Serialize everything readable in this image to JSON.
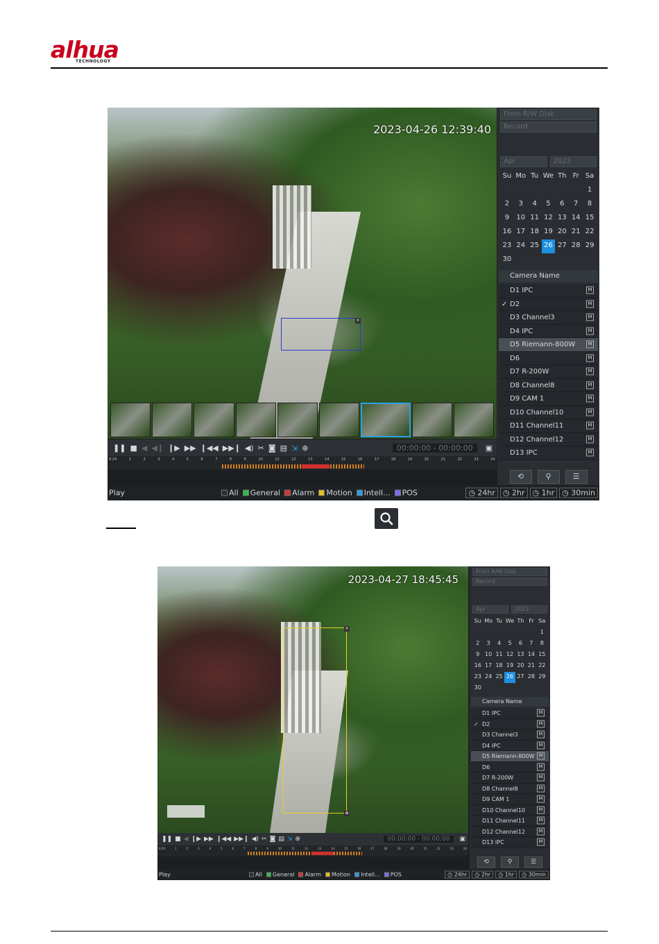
{
  "logo": {
    "brand": "alhua",
    "sub": "TECHNOLOGY"
  },
  "icons": {
    "zoom": "magnify-icon"
  },
  "screen1": {
    "timestamp": "2023-04-26 12:39:40",
    "source": "From R/W Disk",
    "type": "Record",
    "month": "Apr",
    "year": "2023",
    "weekdays": [
      "Su",
      "Mo",
      "Tu",
      "We",
      "Th",
      "Fr",
      "Sa"
    ],
    "weeks": [
      [
        "",
        "",
        "",
        "",
        "",
        "",
        "1"
      ],
      [
        "2",
        "3",
        "4",
        "5",
        "6",
        "7",
        "8"
      ],
      [
        "9",
        "10",
        "11",
        "12",
        "13",
        "14",
        "15"
      ],
      [
        "16",
        "17",
        "18",
        "19",
        "20",
        "21",
        "22"
      ],
      [
        "23",
        "24",
        "25",
        "26",
        "27",
        "28",
        "29"
      ],
      [
        "30",
        "",
        "",
        "",
        "",
        "",
        ""
      ]
    ],
    "camera_header": "Camera Name",
    "cameras": [
      "D1 IPC",
      "D2",
      "D3 Channel3",
      "D4 IPC",
      "D5 Riemann-800W",
      "D6",
      "D7 R-200W",
      "D8 Channel8",
      "D9 CAM 1",
      "D10 Channel10",
      "D11 Channel11",
      "D12 Channel12",
      "D13 IPC"
    ],
    "checked_camera": "✓",
    "m_label": "M",
    "time_start": "00:00:00",
    "time_sep": "-",
    "time_end": "00:00:00",
    "ticks": [
      "0:24",
      "1",
      "2",
      "3",
      "4",
      "5",
      "6",
      "7",
      "8",
      "9",
      "10",
      "11",
      "12",
      "13",
      "14",
      "15",
      "16",
      "17",
      "18",
      "19",
      "20",
      "21",
      "22",
      "23",
      "24"
    ],
    "play_label": "Play",
    "legend": [
      {
        "label": "All",
        "color": "#2a2e32"
      },
      {
        "label": "General",
        "color": "#2fbf4a"
      },
      {
        "label": "Alarm",
        "color": "#d8302f"
      },
      {
        "label": "Motion",
        "color": "#e6c21e"
      },
      {
        "label": "Intell...",
        "color": "#2aa0e6"
      },
      {
        "label": "POS",
        "color": "#7b6cf0"
      }
    ],
    "ranges": [
      "24hr",
      "2hr",
      "1hr",
      "30min"
    ]
  },
  "screen2": {
    "timestamp": "2023-04-27 18:45:45",
    "overlay_text": "  "
  }
}
